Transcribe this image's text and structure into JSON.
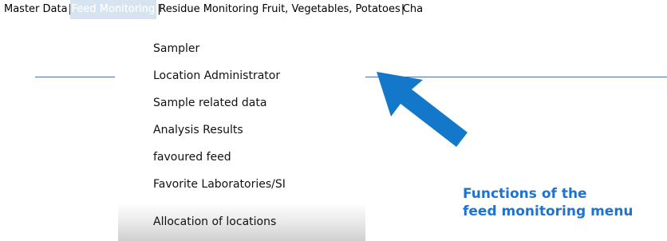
{
  "menubar": {
    "items": [
      {
        "label": "Master Data"
      },
      {
        "label": "Feed Monitoring",
        "active": true
      },
      {
        "label": "Residue Monitoring Fruit, Vegetables, Potatoes"
      },
      {
        "label": "Cha"
      }
    ]
  },
  "dropdown": {
    "items": [
      {
        "label": "Sampler"
      },
      {
        "label": "Location Administrator"
      },
      {
        "label": "Sample related data"
      },
      {
        "label": "Analysis Results"
      },
      {
        "label": "favoured feed"
      },
      {
        "label": "Favorite Laboratories/SI"
      },
      {
        "label": "Allocation of locations",
        "highlighted": true
      }
    ]
  },
  "annotation": {
    "line1": "Functions of the",
    "line2": "feed monitoring menu",
    "arrow_icon": "arrow-pointing-up-left-icon",
    "color": "#1e73d2"
  },
  "colors": {
    "rule_line": "#4a6fa5",
    "active_menu_bg": "#d6e4f2",
    "arrow_fill": "#1378c9"
  }
}
